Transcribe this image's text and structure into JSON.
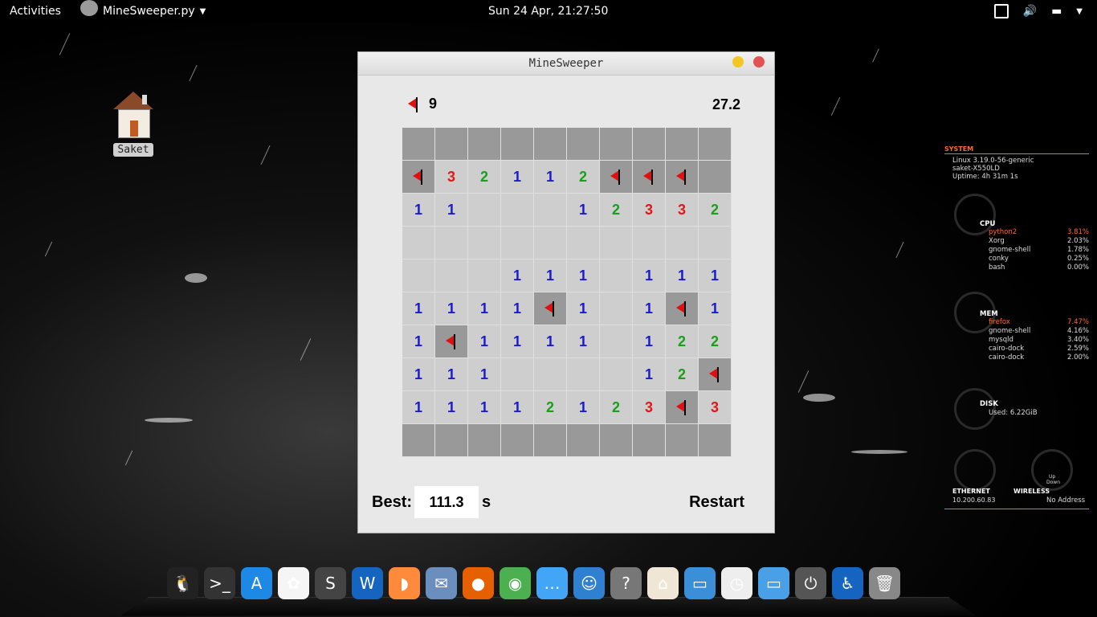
{
  "topbar": {
    "activities": "Activities",
    "app_name": "MineSweeper.py",
    "clock": "Sun 24 Apr, 21:27:50"
  },
  "desktop": {
    "home_label": "Saket"
  },
  "window": {
    "title": "MineSweeper",
    "flags_remaining": "9",
    "timer": "27.2",
    "best_label": "Best:",
    "best_value": "111.3",
    "best_unit": "s",
    "restart_label": "Restart",
    "board": [
      [
        "c",
        "c",
        "c",
        "c",
        "c",
        "c",
        "c",
        "c",
        "c",
        "c"
      ],
      [
        "F",
        "3",
        "2",
        "1",
        "1",
        "2",
        "F",
        "F",
        "F",
        "c"
      ],
      [
        "1",
        "1",
        "o",
        "o",
        "o",
        "1",
        "2",
        "3",
        "3",
        "2"
      ],
      [
        "o",
        "o",
        "o",
        "o",
        "o",
        "o",
        "o",
        "o",
        "o",
        "o"
      ],
      [
        "o",
        "o",
        "o",
        "1",
        "1",
        "1",
        "o",
        "1",
        "1",
        "1"
      ],
      [
        "1",
        "1",
        "1",
        "1",
        "F",
        "1",
        "o",
        "1",
        "F",
        "1"
      ],
      [
        "1",
        "F",
        "1",
        "1",
        "1",
        "1",
        "o",
        "1",
        "2",
        "2"
      ],
      [
        "1",
        "1",
        "1",
        "o",
        "o",
        "o",
        "o",
        "1",
        "2",
        "F"
      ],
      [
        "1",
        "1",
        "1",
        "1",
        "2",
        "1",
        "2",
        "3",
        "F",
        "3"
      ],
      [
        "c",
        "c",
        "c",
        "c",
        "c",
        "c",
        "c",
        "c",
        "c",
        "c"
      ]
    ]
  },
  "conky": {
    "system_header": "SYSTEM",
    "kernel": "Linux 3.19.0-56-generic",
    "host": "saket-X550LD",
    "uptime": "Uptime: 4h 31m 1s",
    "cpu_header": "CPU",
    "cpu_procs": [
      {
        "name": "python2",
        "val": "3.81%"
      },
      {
        "name": "Xorg",
        "val": "2.03%"
      },
      {
        "name": "gnome-shell",
        "val": "1.78%"
      },
      {
        "name": "conky",
        "val": "0.25%"
      },
      {
        "name": "bash",
        "val": "0.00%"
      }
    ],
    "mem_header": "MEM",
    "mem_procs": [
      {
        "name": "firefox",
        "val": "7.47%"
      },
      {
        "name": "gnome-shell",
        "val": "4.16%"
      },
      {
        "name": "mysqld",
        "val": "3.40%"
      },
      {
        "name": "cairo-dock",
        "val": "2.59%"
      },
      {
        "name": "cairo-dock",
        "val": "2.00%"
      }
    ],
    "disk_header": "DISK",
    "disk_used": "Used: 6.22GiB",
    "eth_header": "ETHERNET",
    "eth_ip": "10.200.60.83",
    "wifi_header": "WIRELESS",
    "wifi_addr": "No Address",
    "up_label": "Up",
    "down_label": "Down"
  },
  "dock": [
    {
      "name": "tux-icon",
      "color": "#222",
      "glyph": "🐧"
    },
    {
      "name": "terminal-icon",
      "color": "#333",
      "glyph": ">_"
    },
    {
      "name": "app-store-icon",
      "color": "#1e88e5",
      "glyph": "A"
    },
    {
      "name": "photos-icon",
      "color": "#f5f5f5",
      "glyph": "✿"
    },
    {
      "name": "sublime-icon",
      "color": "#444",
      "glyph": "S"
    },
    {
      "name": "word-icon",
      "color": "#1565c0",
      "glyph": "W"
    },
    {
      "name": "orange-slice-icon",
      "color": "#ff8a3c",
      "glyph": "◗"
    },
    {
      "name": "mail-icon",
      "color": "#6a8fbf",
      "glyph": "✉"
    },
    {
      "name": "firefox-icon",
      "color": "#e66000",
      "glyph": "●"
    },
    {
      "name": "chrome-icon",
      "color": "#4caf50",
      "glyph": "◉"
    },
    {
      "name": "chat-icon",
      "color": "#42a5f5",
      "glyph": "…"
    },
    {
      "name": "finder-icon",
      "color": "#2f80d1",
      "glyph": "☺"
    },
    {
      "name": "help-icon",
      "color": "#777",
      "glyph": "?"
    },
    {
      "name": "home-folder-icon",
      "color": "#f0e6d6",
      "glyph": "⌂"
    },
    {
      "name": "documents-icon",
      "color": "#3b8fd8",
      "glyph": "▭"
    },
    {
      "name": "clock-icon",
      "color": "#eeeeee",
      "glyph": "◷"
    },
    {
      "name": "folder-icon",
      "color": "#4aa0e6",
      "glyph": "▭"
    },
    {
      "name": "power-icon",
      "color": "#555",
      "glyph": "⏻"
    },
    {
      "name": "accessibility-icon",
      "color": "#1565c0",
      "glyph": "♿"
    },
    {
      "name": "trash-icon",
      "color": "#888",
      "glyph": "🗑"
    }
  ]
}
